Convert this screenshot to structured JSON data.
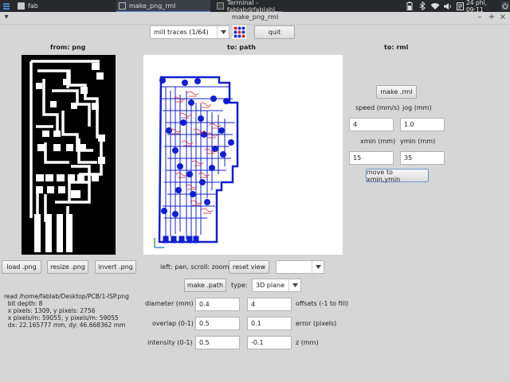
{
  "taskbar": {
    "tasks": [
      {
        "label": "fab",
        "active": false
      },
      {
        "label": "make_png_rml",
        "active": true
      },
      {
        "label": "Terminal - fablab@fablabL...",
        "active": false
      }
    ],
    "clock": "24 phi, 09:11",
    "tray_icons": [
      "battery-icon",
      "bluetooth-icon",
      "wifi-icon",
      "volume-icon",
      "notification-icon",
      "power-icon"
    ]
  },
  "window": {
    "title": "make_png_rml",
    "buttons": [
      "minimize",
      "maximize",
      "close"
    ]
  },
  "toolbar": {
    "process_value": "mill traces (1/64)",
    "quit_label": "quit",
    "accent_red": "#e02020",
    "accent_blue": "#1c2bd0"
  },
  "headers": {
    "from": "from: png",
    "to_path": "to: path",
    "to_rml": "to: rml"
  },
  "png_panel": {
    "load_label": "load .png",
    "resize_label": "resize .png",
    "invert_label": "invert .png"
  },
  "path_panel": {
    "hint": "left: pan, scroll: zoom",
    "reset_label": "reset view",
    "view_value": "",
    "make_path_label": "make .path",
    "type_label": "type:",
    "type_value": "3D plane",
    "path_color": "#1020d0",
    "offset_color": "#d02030"
  },
  "params": {
    "diameter_label": "diameter (mm)",
    "diameter_value": "0.4",
    "offsets_value": "4",
    "offsets_label": "offsets (-1 to fill)",
    "overlap_label": "overlap (0-1)",
    "overlap_value": "0.5",
    "error_value": "0.1",
    "error_label": "error (pixels)",
    "intensity_label": "intensity (0-1)",
    "intensity_value": "0.5",
    "z_value": "-0.1",
    "z_label": "z (mm)"
  },
  "rml_panel": {
    "make_rml_label": "make .rml",
    "speed_label": "speed (mm/s)",
    "jog_label": "jog (mm)",
    "speed_value": "4",
    "jog_value": "1.0",
    "xmin_label": "xmin (mm)",
    "ymin_label": "ymin (mm)",
    "xmin_value": "15",
    "ymin_value": "35",
    "move_label": "move to xmin,ymin"
  },
  "info": {
    "line1": "read /home/fablab/Desktop/PCB/1-ISP.png",
    "line2": "  bit depth: 8",
    "line3": "  x pixels: 1309, y pixels: 2756",
    "line4": "  x pixels/m: 59055, y pixels/m: 59055",
    "line5": "  dx: 22.165777 mm, dy: 46.668362 mm"
  }
}
